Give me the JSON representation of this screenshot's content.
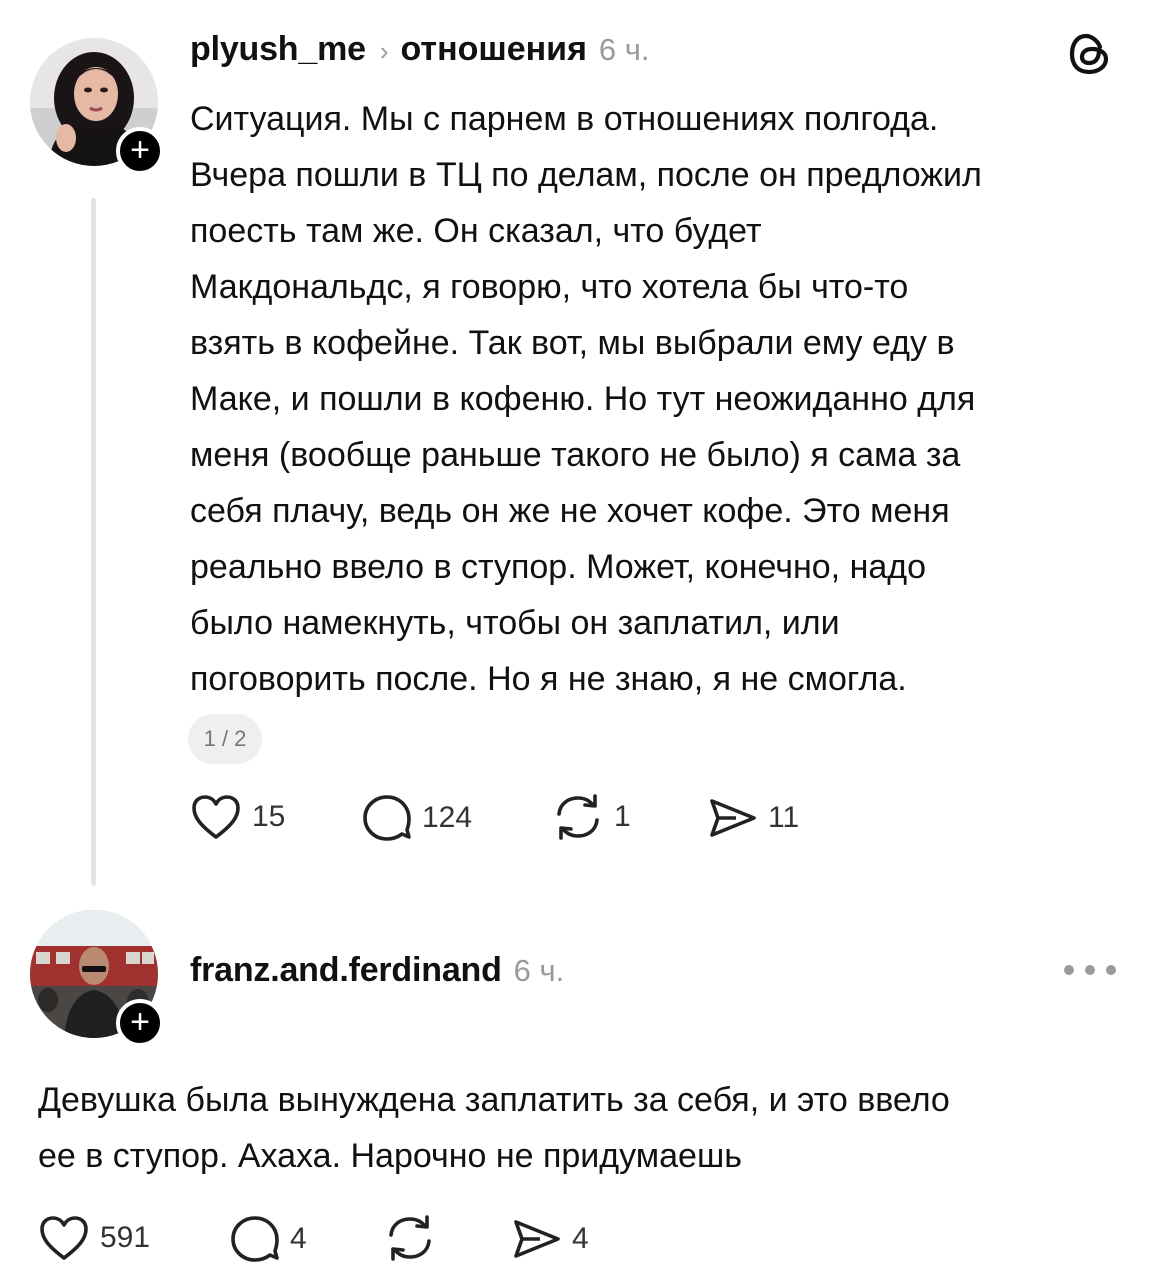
{
  "post1": {
    "username": "plyush_me",
    "topic": "отношения",
    "time": "6 ч.",
    "text_lines": [
      "Ситуация. Мы с парнем в отношениях полгода.",
      "Вчера пошли в ТЦ по делам, после он предложил",
      "поесть там же. Он сказал, что будет",
      "Макдональдс, я говорю, что хотела бы что-то",
      "взять в кофейне. Так вот, мы выбрали ему еду в",
      "Маке, и пошли в кофеню. Но тут неожиданно для",
      "меня (вообще раньше такого не было) я сама за",
      "себя плачу, ведь он же не хочет кофе. Это меня",
      "реально ввело в ступор. Может, конечно, надо",
      "было намекнуть, чтобы он заплатил, или",
      "поговорить после. Но я не знаю, я не смогла."
    ],
    "page_indicator": "1 / 2",
    "likes": "15",
    "comments": "124",
    "reposts": "1",
    "shares": "11"
  },
  "post2": {
    "username": "franz.and.ferdinand",
    "time": "6 ч.",
    "text_lines": [
      "Девушка была вынуждена заплатить за себя, и это ввело",
      "ее в ступор. Ахаха. Нарочно не придумаешь"
    ],
    "likes": "591",
    "comments": "4",
    "reposts": "",
    "shares": "4"
  },
  "icons": {
    "threads_logo": "threads-logo-icon",
    "follow": "plus-icon",
    "like": "heart-icon",
    "comment": "comment-icon",
    "repost": "repost-icon",
    "share": "share-icon",
    "more": "more-icon"
  },
  "colors": {
    "text": "#111111",
    "muted": "#9a9a9a",
    "thread_line": "#e3e3e3",
    "badge": "#000000"
  }
}
